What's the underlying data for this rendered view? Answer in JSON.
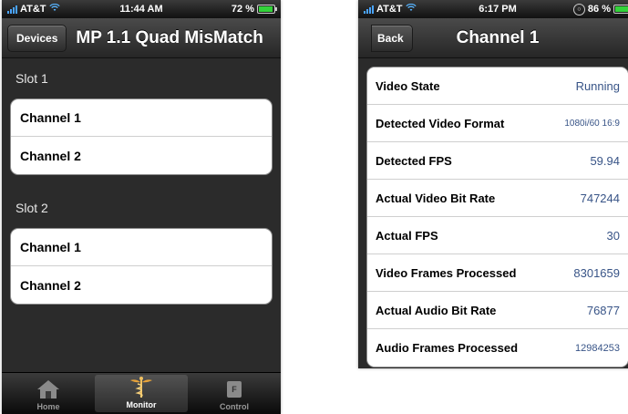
{
  "left": {
    "status": {
      "carrier": "AT&T",
      "time": "11:44 AM",
      "battery": "72 %"
    },
    "nav": {
      "button": "Devices",
      "title": "MP 1.1 Quad MisMatch"
    },
    "sections": [
      {
        "header": "Slot 1",
        "items": [
          "Channel 1",
          "Channel 2"
        ]
      },
      {
        "header": "Slot 2",
        "items": [
          "Channel 1",
          "Channel 2"
        ]
      }
    ],
    "tabs": [
      {
        "label": "Home",
        "icon": "home-icon",
        "active": false
      },
      {
        "label": "Monitor",
        "icon": "caduceus-icon",
        "active": true
      },
      {
        "label": "Control",
        "icon": "control-icon",
        "active": false,
        "glyph": "F"
      }
    ]
  },
  "right": {
    "status": {
      "carrier": "AT&T",
      "time": "6:17 PM",
      "battery": "86 %"
    },
    "nav": {
      "button": "Back",
      "title": "Channel 1"
    },
    "rows": [
      {
        "label": "Video State",
        "value": "Running"
      },
      {
        "label": "Detected Video Format",
        "value": "1080i/60 16:9"
      },
      {
        "label": "Detected FPS",
        "value": "59.94"
      },
      {
        "label": "Actual Video Bit Rate",
        "value": "747244"
      },
      {
        "label": "Actual FPS",
        "value": "30"
      },
      {
        "label": "Video Frames Processed",
        "value": "8301659"
      },
      {
        "label": "Actual Audio Bit Rate",
        "value": "76877"
      },
      {
        "label": "Audio Frames Processed",
        "value": "12984253"
      }
    ]
  },
  "colors": {
    "value_text": "#385487",
    "battery_fill": "#33d33a",
    "wifi": "#58b4ff"
  }
}
